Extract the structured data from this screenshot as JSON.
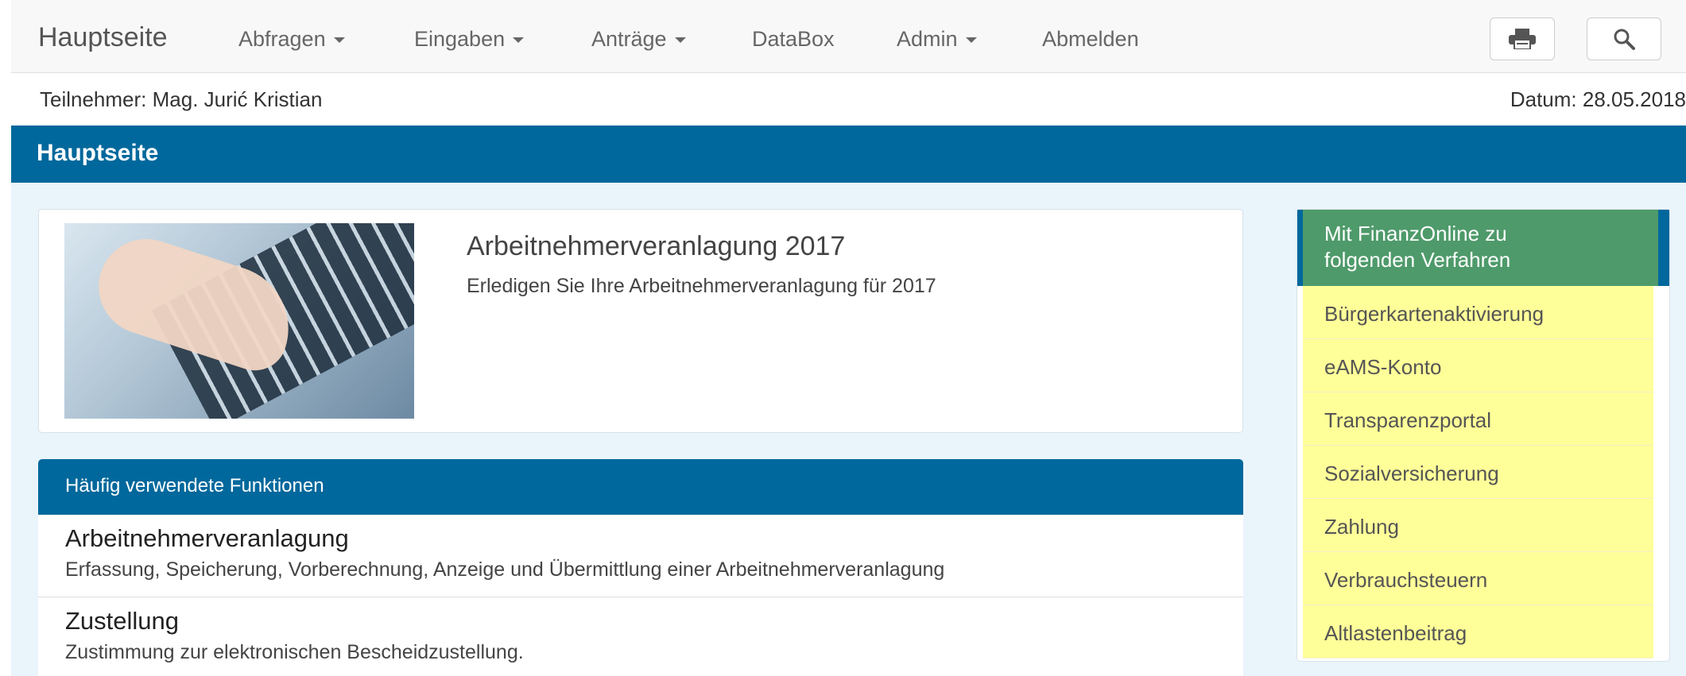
{
  "navbar": {
    "brand": "Hauptseite",
    "items": [
      {
        "label": "Abfragen",
        "dropdown": true
      },
      {
        "label": "Eingaben",
        "dropdown": true
      },
      {
        "label": "Anträge",
        "dropdown": true
      },
      {
        "label": "DataBox",
        "dropdown": false
      },
      {
        "label": "Admin",
        "dropdown": true
      },
      {
        "label": "Abmelden",
        "dropdown": false
      }
    ],
    "buttons": {
      "print_icon": "print-icon",
      "search_icon": "search-icon"
    }
  },
  "info": {
    "participant": "Teilnehmer:  Mag. Jurić Kristian",
    "date": "Datum: 28.05.2018"
  },
  "page_title": "Hauptseite",
  "feature": {
    "title": "Arbeitnehmerveranlagung 2017",
    "description": "Erledigen Sie Ihre Arbeitnehmerveranlagung für 2017"
  },
  "functions": {
    "header": "Häufig verwendete Funktionen",
    "items": [
      {
        "title": "Arbeitnehmerveranlagung",
        "description": "Erfassung, Speicherung, Vorberechnung, Anzeige und Übermittlung einer Arbeitnehmerveranlagung"
      },
      {
        "title": "Zustellung",
        "description": "Zustimmung zur elektronischen Bescheidzustellung."
      }
    ]
  },
  "sidebar": {
    "header": "Mit FinanzOnline zu folgenden Verfahren",
    "items": [
      "Bürgerkartenaktivierung",
      "eAMS-Konto",
      "Transparenzportal",
      "Sozialversicherung",
      "Zahlung",
      "Verbrauchsteuern",
      "Altlastenbeitrag"
    ]
  },
  "colors": {
    "primary": "#00689c",
    "sidebar_header": "#4e9a6a",
    "sidebar_item": "#ffff99",
    "content_bg": "#eaf4fb"
  }
}
